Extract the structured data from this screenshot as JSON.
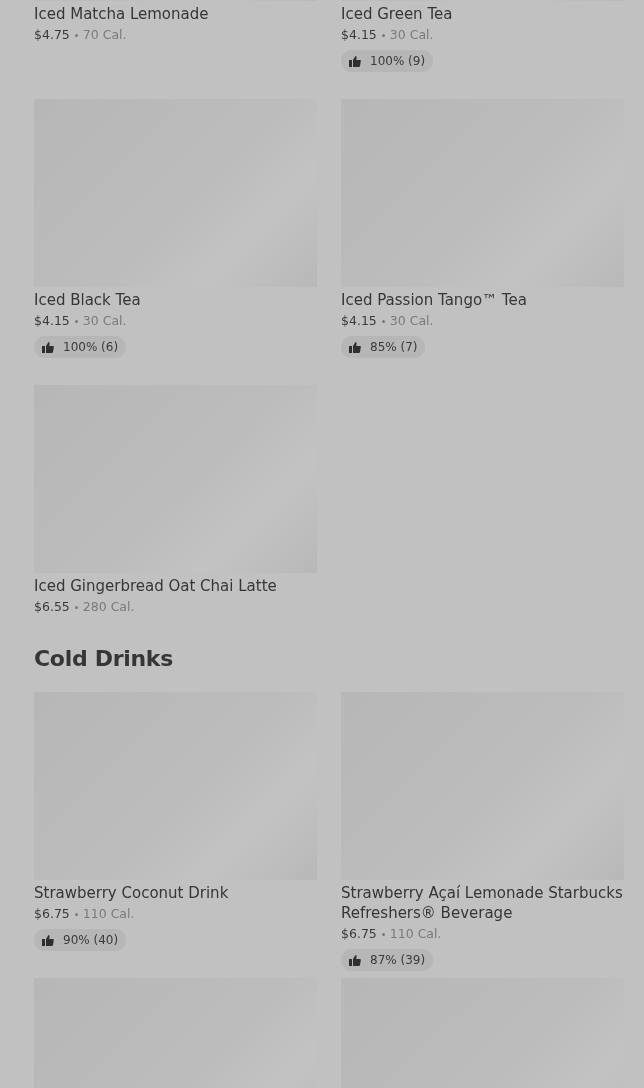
{
  "sections": [
    {
      "items": [
        {
          "kind": "full",
          "name": "Iced Matcha Lemonade",
          "price": "$4.75",
          "calories": "70 Cal."
        },
        {
          "kind": "full",
          "name": "Iced Green Tea",
          "price": "$4.15",
          "calories": "30 Cal.",
          "rating": "100% (9)"
        },
        {
          "kind": "full",
          "name": "Iced Black Tea",
          "price": "$4.15",
          "calories": "30 Cal.",
          "rating": "100% (6)"
        },
        {
          "kind": "full",
          "name": "Iced Passion Tango™ Tea",
          "price": "$4.15",
          "calories": "30 Cal.",
          "rating": "85% (7)"
        },
        {
          "kind": "full",
          "name": "Iced Gingerbread Oat Chai Latte",
          "price": "$6.55",
          "calories": "280 Cal."
        }
      ]
    },
    {
      "heading": "Cold Drinks",
      "items": [
        {
          "kind": "full",
          "name": "Strawberry Coconut Drink",
          "price": "$6.75",
          "calories": "110 Cal.",
          "rating": "90% (40)"
        },
        {
          "kind": "full",
          "name": "Strawberry Açaí Lemonade Starbucks Refreshers® Beverage",
          "price": "$6.75",
          "calories": "110 Cal.",
          "rating": "87% (39)"
        },
        {
          "kind": "image_only"
        },
        {
          "kind": "image_only"
        }
      ]
    }
  ]
}
